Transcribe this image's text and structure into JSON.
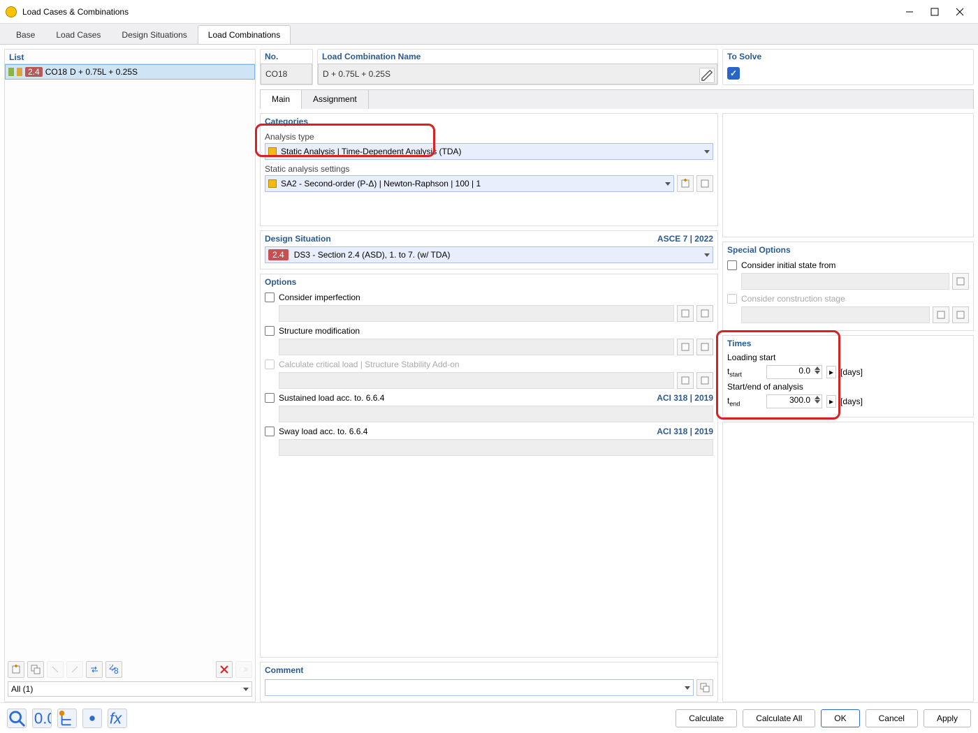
{
  "window": {
    "title": "Load Cases & Combinations"
  },
  "top_tabs": [
    "Base",
    "Load Cases",
    "Design Situations",
    "Load Combinations"
  ],
  "top_tabs_active": 3,
  "list": {
    "header": "List",
    "items": [
      {
        "badge": "2.4",
        "code": "CO18",
        "name": "D + 0.75L + 0.25S"
      }
    ],
    "filter": "All (1)"
  },
  "detail": {
    "no": {
      "label": "No.",
      "value": "CO18"
    },
    "name": {
      "label": "Load Combination Name",
      "value": "D + 0.75L + 0.25S"
    },
    "solve": {
      "label": "To Solve",
      "checked": true
    },
    "inner_tabs": [
      "Main",
      "Assignment"
    ],
    "inner_tabs_active": 0
  },
  "categories": {
    "header": "Categories",
    "analysis_type_label": "Analysis type",
    "analysis_type_value": "Static Analysis | Time-Dependent Analysis (TDA)",
    "sas_label": "Static analysis settings",
    "sas_value": "SA2 - Second-order (P-Δ) | Newton-Raphson | 100 | 1"
  },
  "design_situation": {
    "header": "Design Situation",
    "standard": "ASCE 7 | 2022",
    "badge": "2.4",
    "value": "DS3 - Section 2.4 (ASD), 1. to 7. (w/ TDA)"
  },
  "options": {
    "header": "Options",
    "imperfection": "Consider imperfection",
    "structure_mod": "Structure modification",
    "critical": "Calculate critical load | Structure Stability Add-on",
    "sustained": "Sustained load acc. to. 6.6.4",
    "sustained_std": "ACI 318 | 2019",
    "sway": "Sway load acc. to. 6.6.4",
    "sway_std": "ACI 318 | 2019"
  },
  "special": {
    "header": "Special Options",
    "initial": "Consider initial state from",
    "construction": "Consider construction stage"
  },
  "times": {
    "header": "Times",
    "loading_start_label": "Loading start",
    "tstart_sym": "tstart",
    "tstart_val": "0.0",
    "unit": "[days]",
    "end_label": "Start/end of analysis",
    "tend_sym": "tend",
    "tend_val": "300.0"
  },
  "comment": {
    "header": "Comment",
    "value": ""
  },
  "footer": {
    "calculate": "Calculate",
    "calculate_all": "Calculate All",
    "ok": "OK",
    "cancel": "Cancel",
    "apply": "Apply"
  }
}
